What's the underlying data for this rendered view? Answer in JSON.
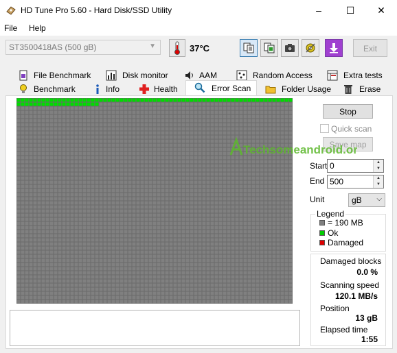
{
  "window": {
    "title": "HD Tune Pro 5.60 - Hard Disk/SSD Utility",
    "minimize": "–",
    "maximize": "☐",
    "close": "✕"
  },
  "menu": {
    "file": "File",
    "help": "Help"
  },
  "toolbar": {
    "drive": "ST3500418AS (500 gB)",
    "temperature": "37°C",
    "exit_label": "Exit"
  },
  "tabs_top": [
    {
      "label": "File Benchmark"
    },
    {
      "label": "Disk monitor"
    },
    {
      "label": "AAM"
    },
    {
      "label": "Random Access"
    },
    {
      "label": "Extra tests"
    }
  ],
  "tabs_bottom": [
    {
      "label": "Benchmark"
    },
    {
      "label": "Info"
    },
    {
      "label": "Health"
    },
    {
      "label": "Error Scan"
    },
    {
      "label": "Folder Usage"
    },
    {
      "label": "Erase"
    }
  ],
  "scan": {
    "stop_label": "Stop",
    "quick_scan_label": "Quick scan",
    "save_map_label": "Save map",
    "start_label": "Start",
    "start_value": "0",
    "end_label": "End",
    "end_value": "500",
    "unit_label": "Unit",
    "unit_value": "gB",
    "progress_fraction": 0.026,
    "block_color_unscanned": "#808080",
    "block_color_ok": "#00dd00"
  },
  "legend": {
    "title": "Legend",
    "block_size": "= 190 MB",
    "ok": "Ok",
    "damaged": "Damaged",
    "color_block": "#808080",
    "color_ok": "#00cc00",
    "color_damaged": "#dd0000"
  },
  "stats": {
    "damaged_blocks_label": "Damaged blocks",
    "damaged_blocks_value": "0.0 %",
    "scanning_speed_label": "Scanning speed",
    "scanning_speed_value": "120.1 MB/s",
    "position_label": "Position",
    "position_value": "13 gB",
    "elapsed_label": "Elapsed time",
    "elapsed_value": "1:55"
  },
  "watermark": {
    "text": "Techsomeandroid.org"
  }
}
